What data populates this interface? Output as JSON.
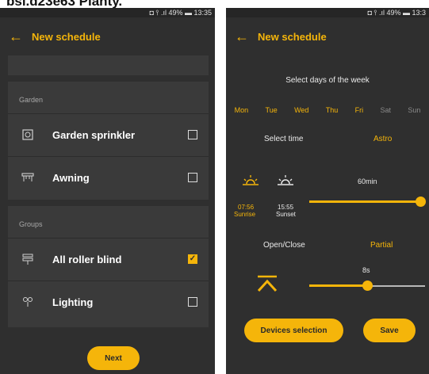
{
  "caption": "bsi.d23e63 Planty.",
  "status_bar": {
    "left_screen": "◘ ⫯ .ıl 49% ▬ 13:35",
    "right_screen": "◘ ⫯ .ıl 49% ▬ 13:3"
  },
  "left": {
    "title": "New schedule",
    "sections": [
      {
        "label": "Garden",
        "items": [
          {
            "name": "Garden sprinkler",
            "icon": "sprinkler-icon",
            "checked": false
          },
          {
            "name": "Awning",
            "icon": "awning-icon",
            "checked": false
          }
        ]
      },
      {
        "label": "Groups",
        "items": [
          {
            "name": "All roller blind",
            "icon": "roller-blind-icon",
            "checked": true
          },
          {
            "name": "Lighting",
            "icon": "lighting-icon",
            "checked": false
          }
        ]
      }
    ],
    "next_label": "Next"
  },
  "right": {
    "title": "New schedule",
    "days_heading": "Select days of the week",
    "days": [
      {
        "label": "Mon",
        "selected": true
      },
      {
        "label": "Tue",
        "selected": true
      },
      {
        "label": "Wed",
        "selected": true
      },
      {
        "label": "Thu",
        "selected": true
      },
      {
        "label": "Fri",
        "selected": true
      },
      {
        "label": "Sat",
        "selected": false
      },
      {
        "label": "Sun",
        "selected": false
      }
    ],
    "select_time_label": "Select time",
    "astro_label": "Astro",
    "sunrise_time": "07:56",
    "sunrise_label": "Sunrise",
    "sunset_time": "15:55",
    "sunset_label": "Sunset",
    "offset_value": "60min",
    "offset_fraction": 1.0,
    "open_close_label": "Open/Close",
    "partial_label": "Partial",
    "partial_value": "8s",
    "partial_fraction": 0.5,
    "devices_selection_label": "Devices selection",
    "save_label": "Save"
  },
  "colors": {
    "accent": "#f5b50a",
    "background": "#2f2f2f",
    "card": "#3a3a3a",
    "muted_day": "#8a8a8a"
  }
}
